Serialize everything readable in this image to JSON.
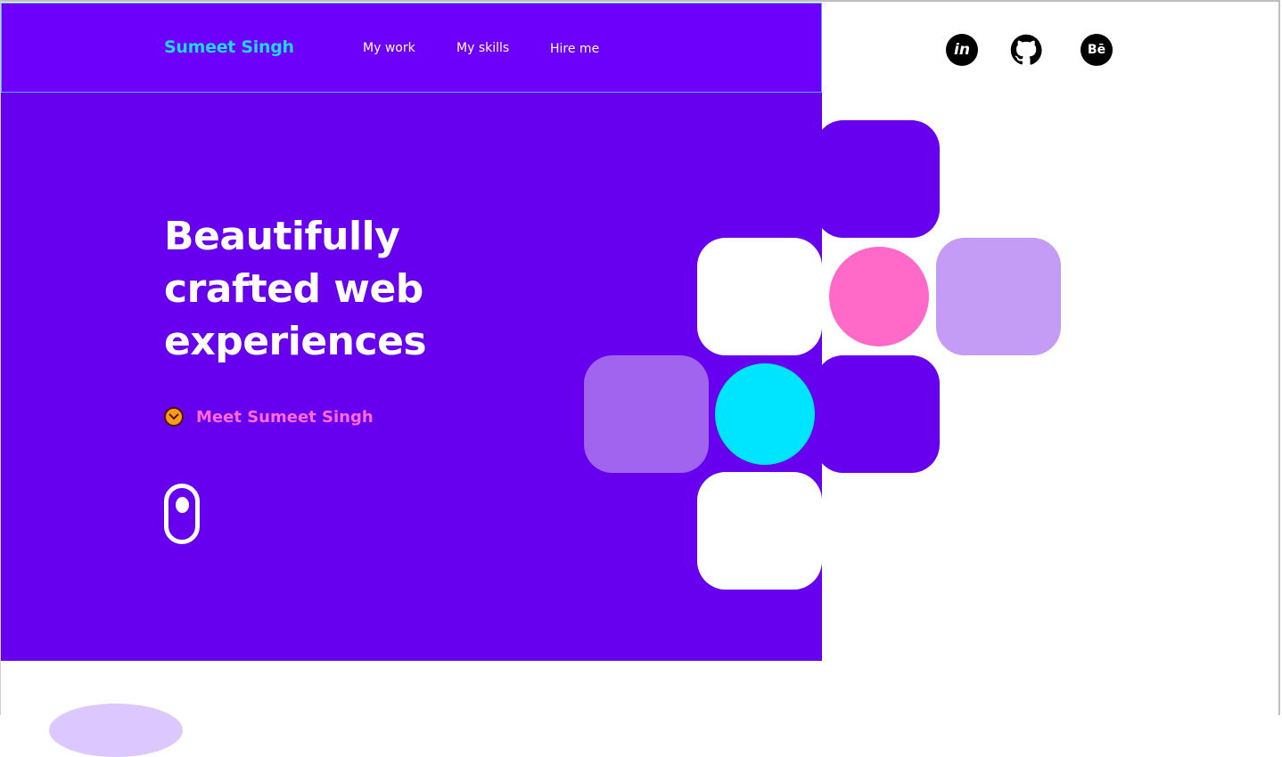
{
  "brand": {
    "name": "Sumeet Singh"
  },
  "nav": {
    "links": [
      {
        "label": "My work"
      },
      {
        "label": "My skills"
      },
      {
        "label": "Hire me"
      }
    ]
  },
  "hero": {
    "headline_lines": [
      "Beautifully",
      "crafted web",
      "experiences"
    ],
    "cta_label": "Meet Sumeet Singh"
  },
  "social": {
    "invision_glyph": "in",
    "behance_glyph": "Bē",
    "icons": [
      "invision-icon",
      "github-icon",
      "behance-icon"
    ]
  },
  "colors": {
    "primary": "#6600ee",
    "accent_cyan": "#00e5ff",
    "accent_pink": "#ff6ac9",
    "lilac": "#c49cf5",
    "violet_soft": "#a164ef"
  }
}
